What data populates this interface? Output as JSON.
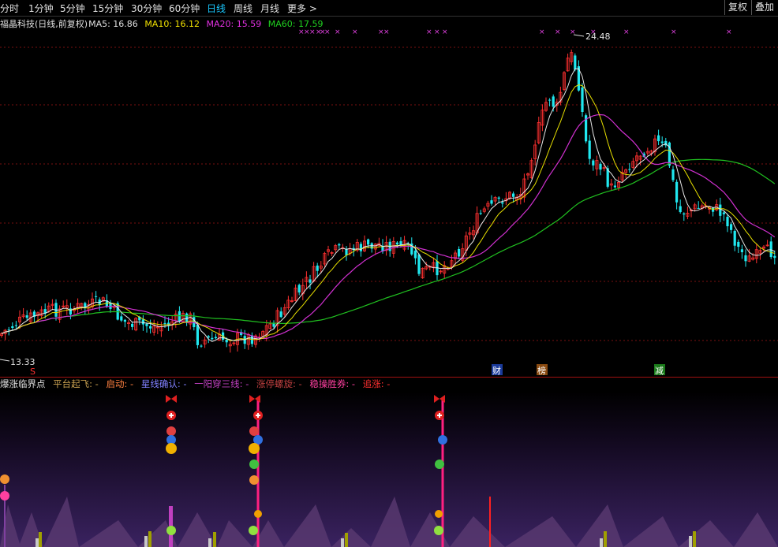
{
  "toolbar": {
    "periods": [
      "分时",
      "1分钟",
      "5分钟",
      "15分钟",
      "30分钟",
      "60分钟",
      "日线",
      "周线",
      "月线",
      "更多 >"
    ],
    "active": "日线",
    "right_buttons": [
      "复权",
      "叠加"
    ]
  },
  "info_bar": {
    "title": "福晶科技(日线,前复权)",
    "ma5": "MA5: 16.86",
    "ma10": "MA10: 16.12",
    "ma20": "MA20: 15.59",
    "ma60": "MA60: 17.59",
    "colors": {
      "title": "#e0e0e0",
      "ma5": "#e0e0e0",
      "ma10": "#f0e000",
      "ma20": "#e030e0",
      "ma60": "#20d020"
    }
  },
  "price_chart": {
    "high_label": "24.48",
    "low_label": "13.33",
    "up_color": "#ff3030",
    "down_color": "#20e8f0",
    "markers": [
      "S",
      "财",
      "榜",
      "减"
    ]
  },
  "indicator": {
    "title": "爆涨临界点",
    "legend": [
      {
        "label": "平台起飞: -",
        "color": "#c8a050"
      },
      {
        "label": "启动: -",
        "color": "#ff8040"
      },
      {
        "label": "星线确认: -",
        "color": "#8080ff"
      },
      {
        "label": "一阳穿三线: -",
        "color": "#c040c0"
      },
      {
        "label": "涨停螺旋: -",
        "color": "#c04040"
      },
      {
        "label": "稳操胜券: -",
        "color": "#ff40a0"
      },
      {
        "label": "追涨: -",
        "color": "#ff3030"
      }
    ]
  }
}
